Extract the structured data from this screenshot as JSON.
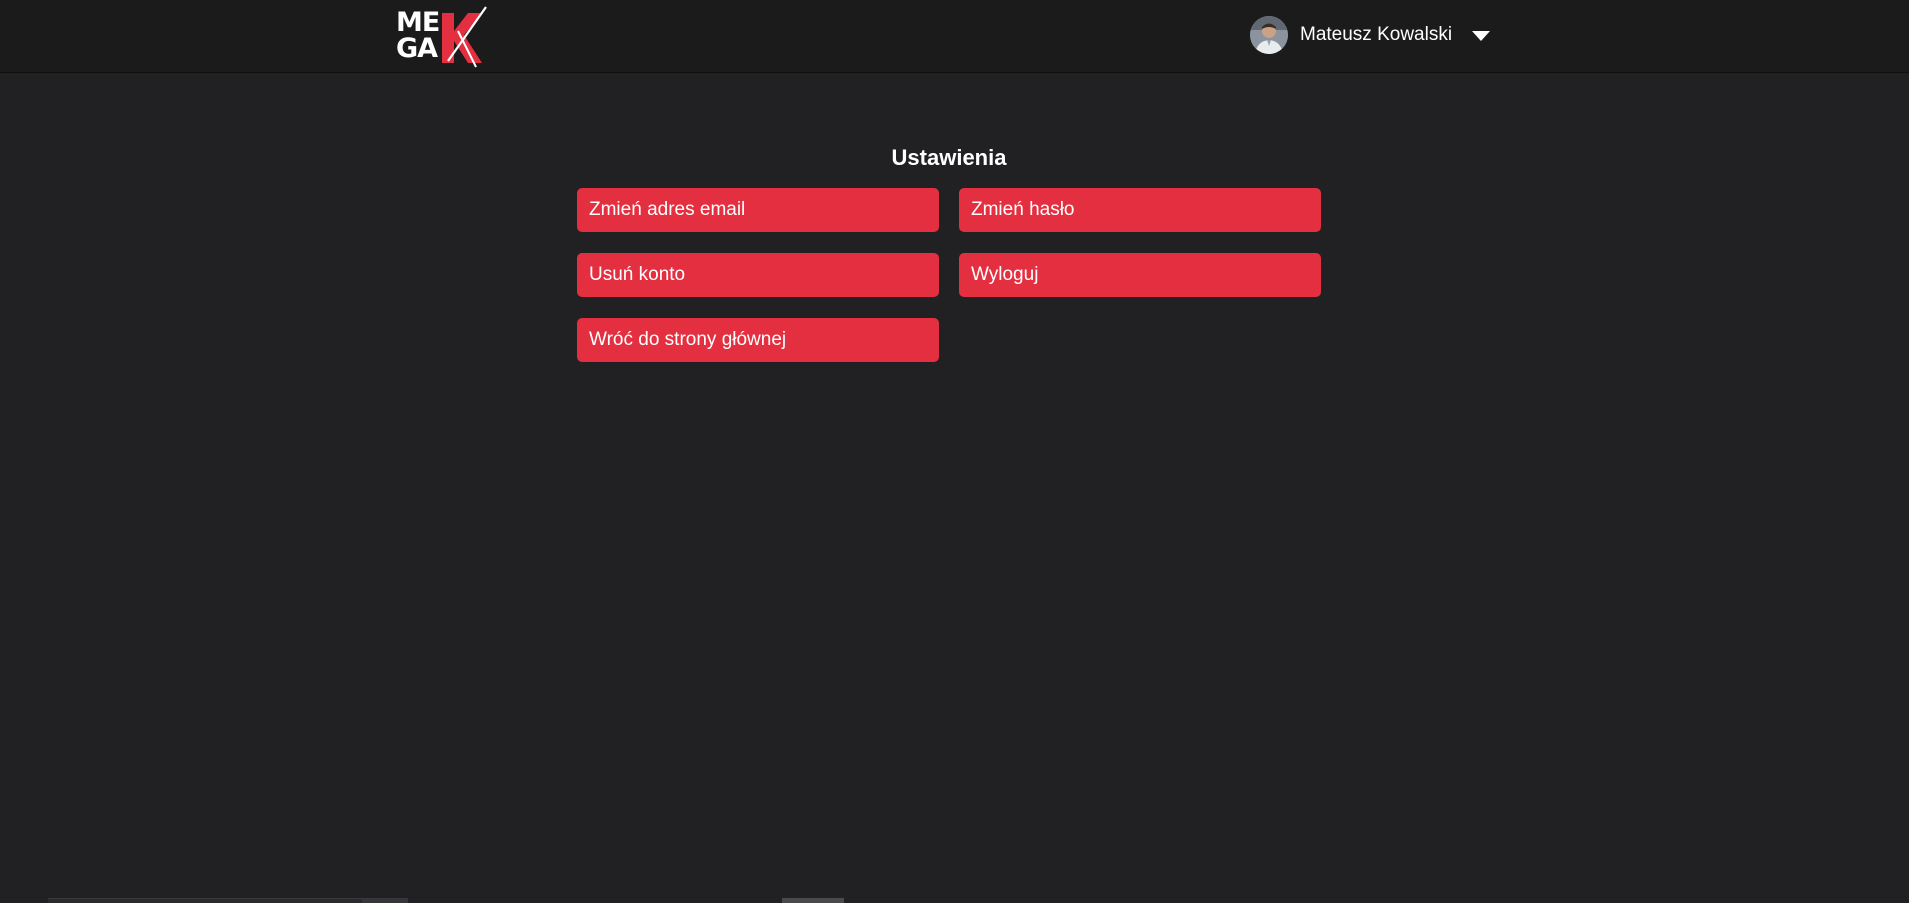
{
  "header": {
    "logo": {
      "line1": "ME",
      "line2": "GA",
      "mark": "K"
    },
    "user": {
      "name": "Mateusz Kowalski",
      "avatar_icon": "user-avatar",
      "menu_icon": "caret-down-icon"
    }
  },
  "main": {
    "title": "Ustawienia",
    "buttons": [
      {
        "label": "Zmień adres email"
      },
      {
        "label": "Zmień hasło"
      },
      {
        "label": "Usuń konto"
      },
      {
        "label": "Wyloguj"
      },
      {
        "label": "Wróć do strony głównej"
      }
    ]
  },
  "colors": {
    "background": "#212124",
    "topbar": "#1b1b1b",
    "accent": "#e32f40",
    "text": "#ffffff"
  }
}
